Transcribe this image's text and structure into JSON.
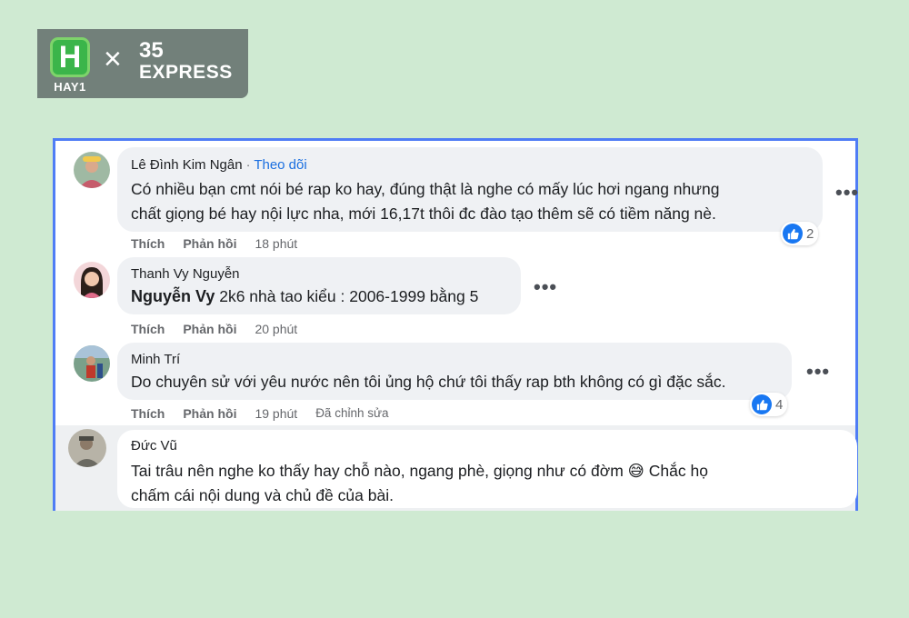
{
  "brand": {
    "logo_letter": "H",
    "logo_caption": "HAY1",
    "separator": "×",
    "partner_line1": "35",
    "partner_line2": "EXPRESS"
  },
  "comments": [
    {
      "author": "Lê Đình Kim Ngân",
      "separator": "·",
      "follow_label": "Theo dõi",
      "lines": [
        "Có nhiều bạn cmt nói bé rap ko hay, đúng thật là nghe có mấy lúc hơi ngang nhưng",
        "chất giọng bé hay nội lực nha, mới 16,17t thôi đc đào tạo thêm sẽ có tiềm năng nè."
      ],
      "like_label": "Thích",
      "reply_label": "Phản hồi",
      "time": "18 phút",
      "reaction_count": "2"
    },
    {
      "author": "Thanh Vy Nguyễn",
      "mention": "Nguyễn Vy",
      "text": " 2k6 nhà tao kiểu : 2006-1999 bằng 5",
      "like_label": "Thích",
      "reply_label": "Phản hồi",
      "time": "20 phút"
    },
    {
      "author": "Minh Trí",
      "text": "Do chuyên sử với yêu nước nên tôi ủng hộ chứ tôi thấy rap bth không có gì đặc sắc.",
      "like_label": "Thích",
      "reply_label": "Phản hồi",
      "time": "19 phút",
      "edited": "Đã chỉnh sửa",
      "reaction_count": "4"
    },
    {
      "author": "Đức Vũ",
      "line1": "Tai trâu nên nghe ko thấy hay chỗ nào, ngang phè, giọng như có đờm",
      "emoji": "😅",
      "line1_end": " Chắc họ",
      "line2": "chấm cái nội dung và chủ đề của bài."
    }
  ],
  "more_glyph": "•••",
  "colors": {
    "background": "#cfead2",
    "panel_border": "#4f7df5",
    "link_blue": "#1b6fe0",
    "like_blue": "#1877f2"
  }
}
